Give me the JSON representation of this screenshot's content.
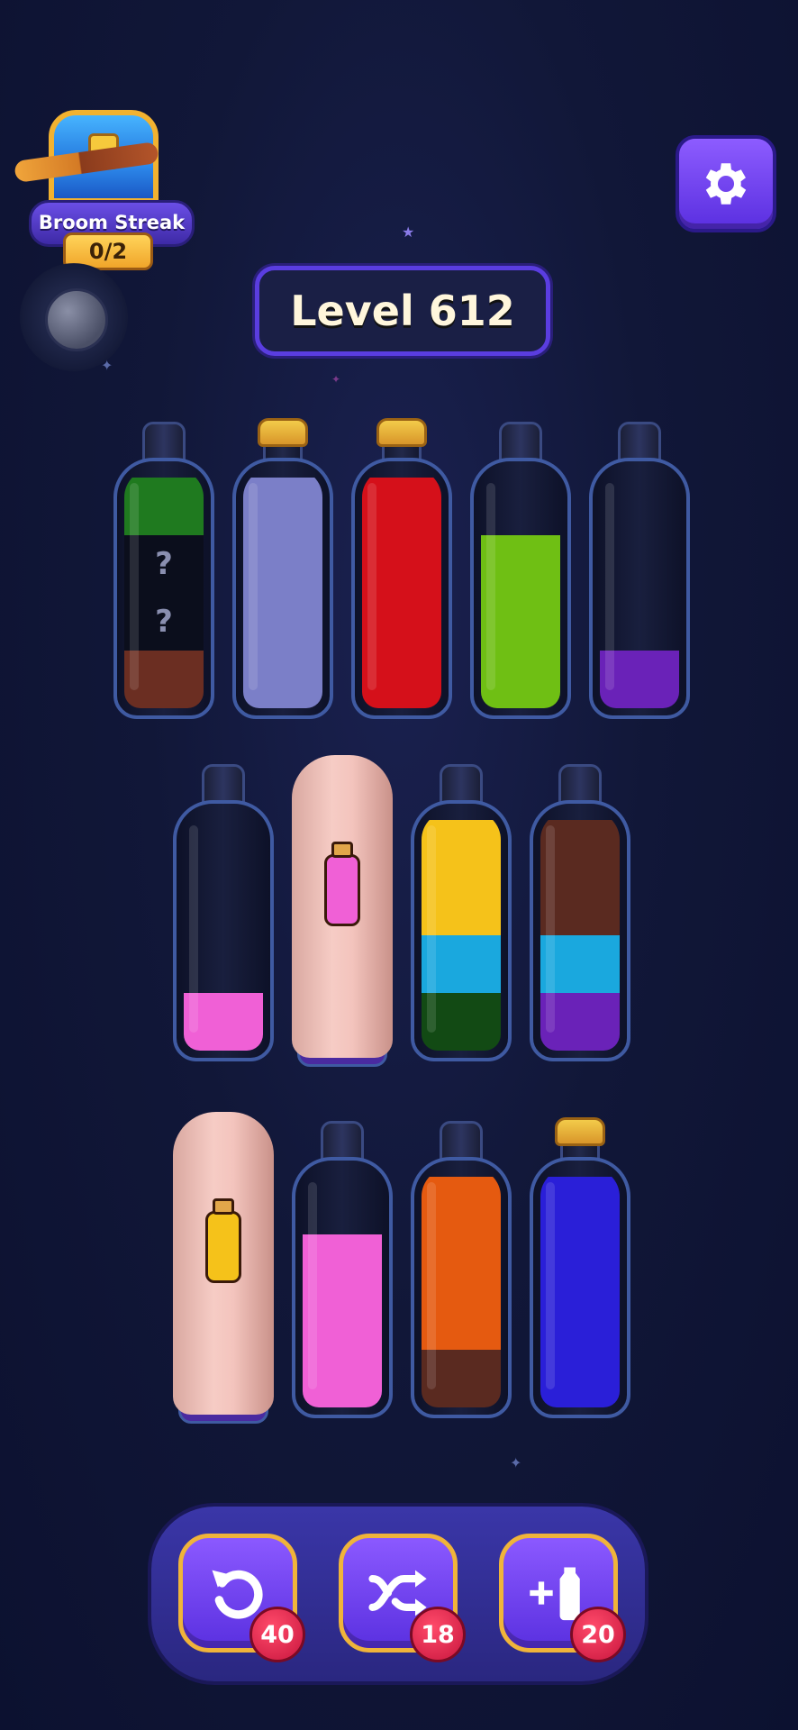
{
  "streak": {
    "label": "Broom Streak",
    "count": "0/2"
  },
  "level": {
    "title": "Level 612"
  },
  "icons": {
    "settings": "gear-icon",
    "undo": "undo-icon",
    "shuffle": "shuffle-icon",
    "add_bottle": "add-bottle-icon",
    "moon": "moon-icon",
    "chest": "treasure-chest-icon"
  },
  "colors": {
    "green": "#1f7a1f",
    "dark": "#0b0e1c",
    "brown": "#6b2e22",
    "lavender": "#7b7fc8",
    "red": "#d5101a",
    "lime": "#6fbf14",
    "purple": "#6a22b8",
    "pink": "#f060d6",
    "yellow": "#f5c21a",
    "cyan": "#1aa8de",
    "darkgreen": "#124a14",
    "orange": "#e55a10",
    "darkbrown": "#5a2a20",
    "blue": "#2a1fd8"
  },
  "bottles_row1": [
    {
      "cork": false,
      "layers": [
        [
          "brown",
          1,
          ""
        ],
        [
          "dark",
          1,
          "?"
        ],
        [
          "dark",
          1,
          "?"
        ],
        [
          "green",
          1,
          ""
        ]
      ]
    },
    {
      "cork": true,
      "layers": [
        [
          "lavender",
          4,
          ""
        ]
      ]
    },
    {
      "cork": true,
      "layers": [
        [
          "red",
          4,
          ""
        ]
      ]
    },
    {
      "cork": false,
      "layers": [
        [
          "lime",
          3,
          ""
        ]
      ]
    },
    {
      "cork": false,
      "layers": [
        [
          "purple",
          1,
          ""
        ]
      ]
    }
  ],
  "bottles_row2": [
    {
      "cork": false,
      "layers": [
        [
          "pink",
          1,
          ""
        ]
      ]
    },
    {
      "covered": true,
      "hint": "pink"
    },
    {
      "cork": false,
      "layers": [
        [
          "darkgreen",
          1,
          ""
        ],
        [
          "cyan",
          1,
          ""
        ],
        [
          "yellow",
          2,
          ""
        ]
      ]
    },
    {
      "cork": false,
      "layers": [
        [
          "purple",
          1,
          ""
        ],
        [
          "cyan",
          1,
          ""
        ],
        [
          "darkbrown",
          2,
          ""
        ]
      ]
    }
  ],
  "bottles_row3": [
    {
      "covered": true,
      "hint": "yellow"
    },
    {
      "cork": false,
      "layers": [
        [
          "pink",
          3,
          ""
        ]
      ]
    },
    {
      "cork": false,
      "layers": [
        [
          "darkbrown",
          1,
          ""
        ],
        [
          "orange",
          3,
          ""
        ]
      ]
    },
    {
      "cork": true,
      "layers": [
        [
          "blue",
          4,
          ""
        ]
      ]
    }
  ],
  "powerups": [
    {
      "name": "undo",
      "count": "40"
    },
    {
      "name": "shuffle",
      "count": "18"
    },
    {
      "name": "add-bottle",
      "count": "20"
    }
  ]
}
